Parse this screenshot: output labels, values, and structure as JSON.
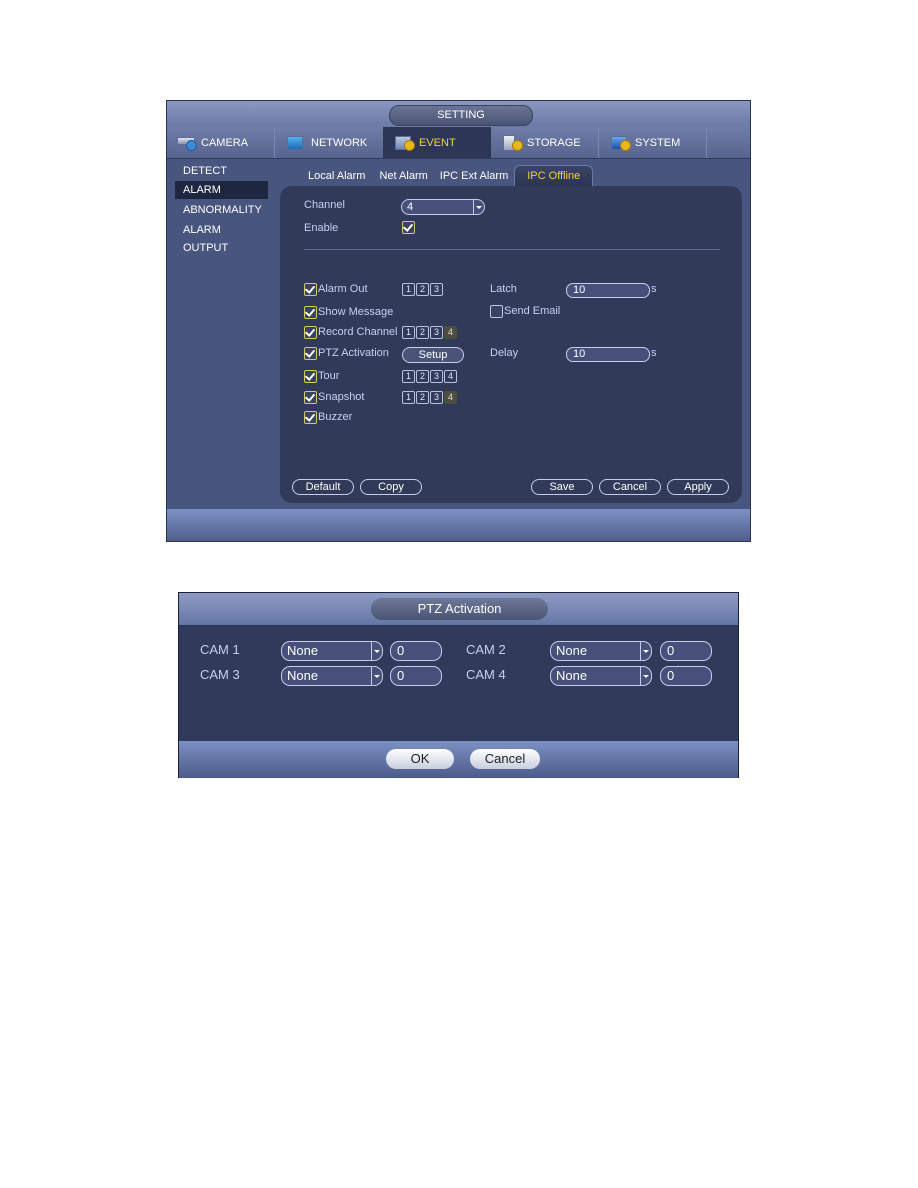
{
  "setting_window": {
    "title": "SETTING",
    "main_tabs": [
      {
        "label": "CAMERA",
        "icon": "camera-icon",
        "active": false
      },
      {
        "label": "NETWORK",
        "icon": "network-icon",
        "active": false
      },
      {
        "label": "EVENT",
        "icon": "event-icon",
        "active": true
      },
      {
        "label": "STORAGE",
        "icon": "storage-icon",
        "active": false
      },
      {
        "label": "SYSTEM",
        "icon": "system-icon",
        "active": false
      }
    ],
    "sidebar": [
      {
        "label": "DETECT",
        "active": false
      },
      {
        "label": "ALARM",
        "active": true
      },
      {
        "label": "ABNORMALITY",
        "active": false
      },
      {
        "label": "ALARM OUTPUT",
        "active": false
      }
    ],
    "sub_tabs": [
      {
        "label": "Local Alarm",
        "active": false
      },
      {
        "label": "Net Alarm",
        "active": false
      },
      {
        "label": "IPC Ext Alarm",
        "active": false
      },
      {
        "label": "IPC Offline",
        "active": true
      }
    ],
    "form": {
      "channel_label": "Channel",
      "channel_value": "4",
      "enable_label": "Enable",
      "enable_checked": true,
      "alarm_out": {
        "label": "Alarm Out",
        "checked": true,
        "channels": [
          "1",
          "2",
          "3"
        ]
      },
      "latch": {
        "label": "Latch",
        "value": "10",
        "unit": "s"
      },
      "show_message": {
        "label": "Show Message",
        "checked": true
      },
      "send_email": {
        "label": "Send Email",
        "checked": false
      },
      "record_channel": {
        "label": "Record Channel",
        "checked": true,
        "channels": [
          "1",
          "2",
          "3",
          "4"
        ],
        "disabled": [
          "4"
        ]
      },
      "ptz_activation": {
        "label": "PTZ Activation",
        "checked": true,
        "button": "Setup"
      },
      "delay": {
        "label": "Delay",
        "value": "10",
        "unit": "s"
      },
      "tour": {
        "label": "Tour",
        "checked": true,
        "channels": [
          "1",
          "2",
          "3",
          "4"
        ]
      },
      "snapshot": {
        "label": "Snapshot",
        "checked": true,
        "channels": [
          "1",
          "2",
          "3",
          "4"
        ],
        "disabled": [
          "4"
        ]
      },
      "buzzer": {
        "label": "Buzzer",
        "checked": true
      }
    },
    "buttons": {
      "default": "Default",
      "copy": "Copy",
      "save": "Save",
      "cancel": "Cancel",
      "apply": "Apply"
    }
  },
  "ptz_dialog": {
    "title": "PTZ Activation",
    "rows": [
      {
        "cam": "CAM 1",
        "type": "None",
        "value": "0"
      },
      {
        "cam": "CAM 2",
        "type": "None",
        "value": "0"
      },
      {
        "cam": "CAM 3",
        "type": "None",
        "value": "0"
      },
      {
        "cam": "CAM 4",
        "type": "None",
        "value": "0"
      }
    ],
    "buttons": {
      "ok": "OK",
      "cancel": "Cancel"
    }
  },
  "colors": {
    "active_tab_text": "#f0d040",
    "panel_bg": "#323a5a",
    "window_bg": "#48557e"
  }
}
